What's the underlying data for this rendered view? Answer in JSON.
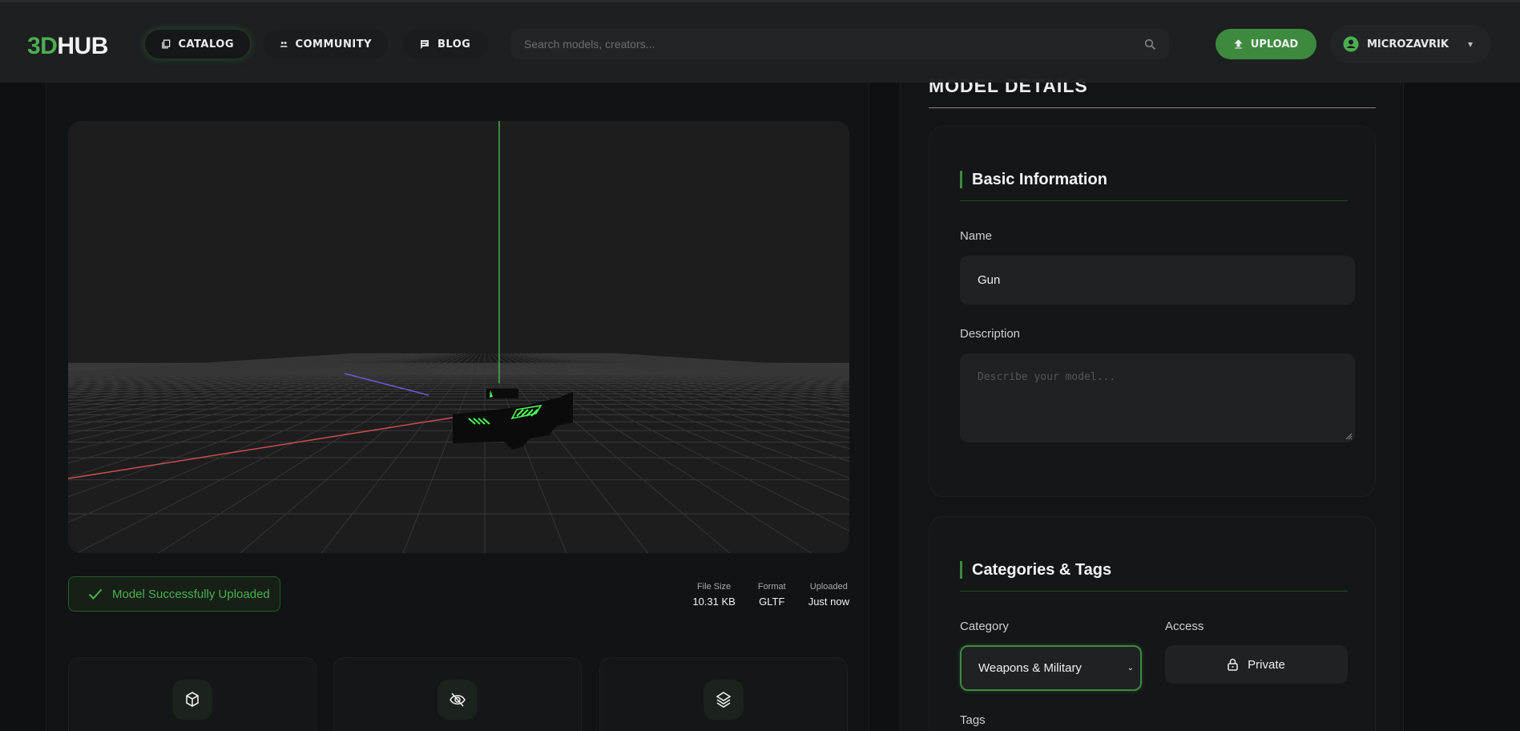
{
  "header": {
    "logo_3d": "3D",
    "logo_hub": "HUB",
    "nav": [
      {
        "label": "CATALOG",
        "icon": "catalog-icon",
        "active": true
      },
      {
        "label": "COMMUNITY",
        "icon": "community-icon",
        "active": false
      },
      {
        "label": "BLOG",
        "icon": "blog-icon",
        "active": false
      }
    ],
    "search_placeholder": "Search models, creators...",
    "upload_label": "UPLOAD",
    "username": "MICROZAVRIK"
  },
  "viewer": {
    "status": "Model Successfully Uploaded",
    "stats": [
      {
        "label": "File Size",
        "value": "10.31 KB"
      },
      {
        "label": "Format",
        "value": "GLTF"
      },
      {
        "label": "Uploaded",
        "value": "Just now"
      }
    ],
    "feature_icons": [
      "cube-icon",
      "eye-off-icon",
      "layers-icon"
    ]
  },
  "details": {
    "title": "MODEL DETAILS",
    "basic": {
      "heading": "Basic Information",
      "name_label": "Name",
      "name_value": "Gun",
      "description_label": "Description",
      "description_placeholder": "Describe your model..."
    },
    "categories": {
      "heading": "Categories & Tags",
      "category_label": "Category",
      "category_value": "Weapons & Military",
      "access_label": "Access",
      "access_value": "Private",
      "tags_label": "Tags"
    }
  },
  "colors": {
    "accent": "#4caf50",
    "accent_dark": "#3d8a3f",
    "bg": "#0f1011"
  }
}
